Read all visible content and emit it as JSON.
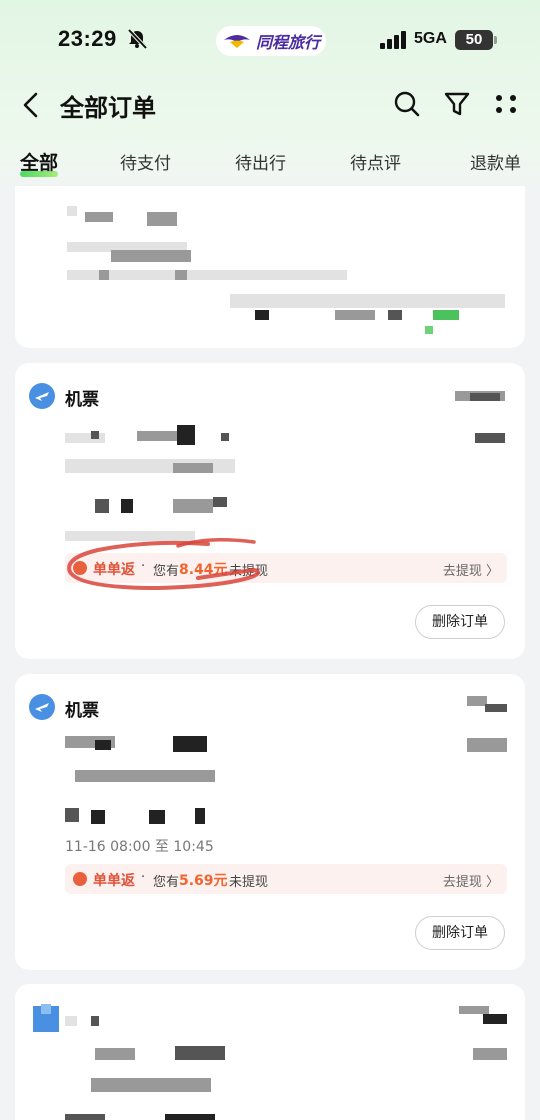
{
  "status_bar": {
    "time": "23:29",
    "brand": "同程旅行",
    "network": "5GA",
    "battery": "50"
  },
  "header": {
    "title": "全部订单"
  },
  "tabs": [
    {
      "label": "全部",
      "active": true
    },
    {
      "label": "待支付",
      "active": false
    },
    {
      "label": "待出行",
      "active": false
    },
    {
      "label": "待点评",
      "active": false
    },
    {
      "label": "退款单",
      "active": false
    }
  ],
  "orders": [
    {
      "category": "机票",
      "cashback": {
        "title": "单单返",
        "dot": "·",
        "pre": "您有",
        "amount": "8.44元",
        "post": "未提现",
        "link": "去提现 〉"
      },
      "delete_label": "删除订单"
    },
    {
      "category": "机票",
      "time_text": "11-16 08:00 至 10:45",
      "cashback": {
        "title": "单单返",
        "dot": "·",
        "pre": "您有",
        "amount": "5.69元",
        "post": "未提现",
        "link": "去提现 〉"
      },
      "delete_label": "删除订单"
    }
  ],
  "colors": {
    "accent_green": "#4cd964",
    "cashback_red": "#e0533a",
    "amount_orange": "#f0642f",
    "icon_blue": "#4a90e2"
  }
}
